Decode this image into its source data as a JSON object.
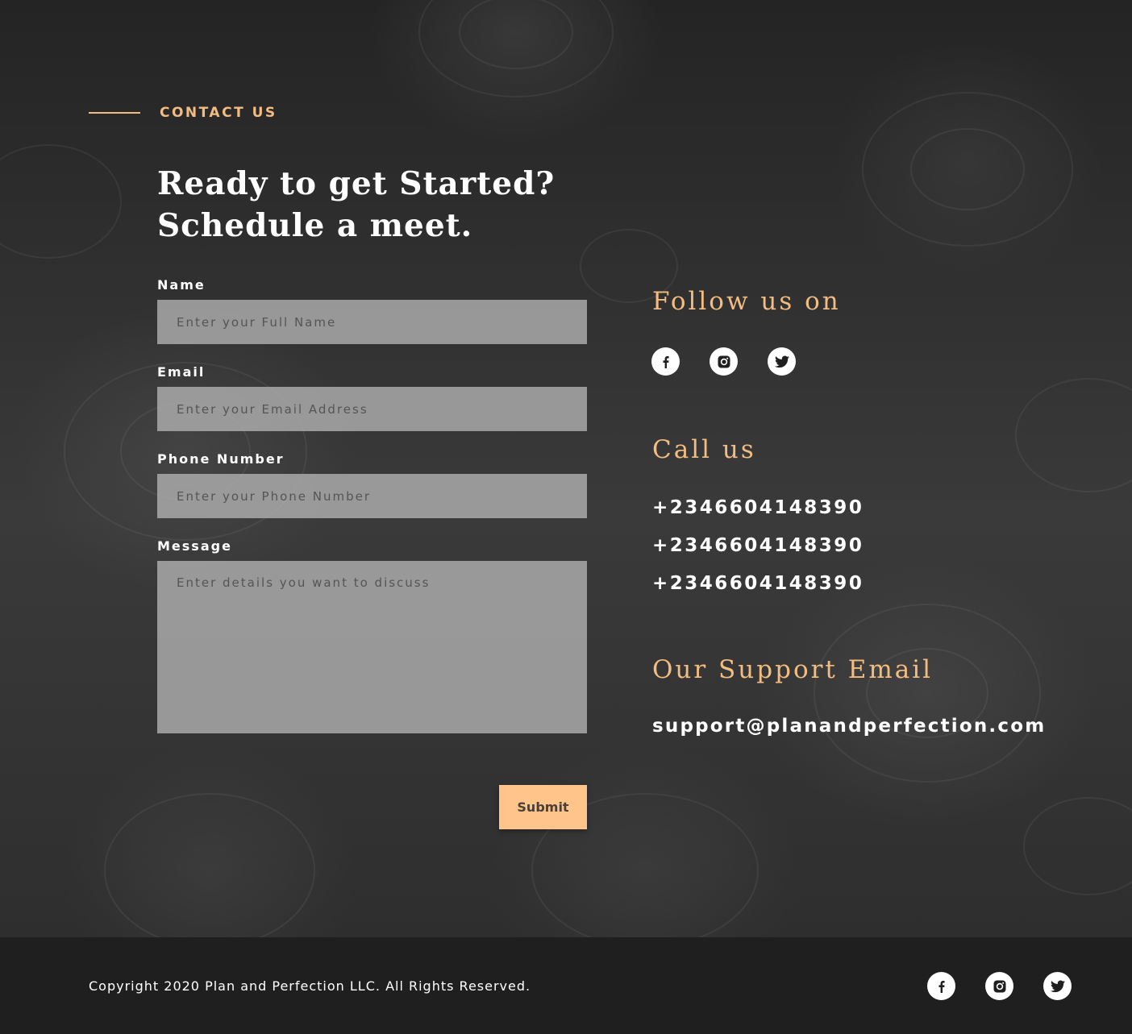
{
  "section": {
    "tag": "CONTACT US"
  },
  "headline": {
    "line1": "Ready to get Started?",
    "line2": "Schedule a meet."
  },
  "form": {
    "name_label": "Name",
    "name_placeholder": "Enter your Full Name",
    "email_label": "Email",
    "email_placeholder": "Enter your Email Address",
    "phone_label": "Phone Number",
    "phone_placeholder": "Enter your Phone Number",
    "message_label": "Message",
    "message_placeholder": "Enter details you want to discuss",
    "submit_label": "Submit"
  },
  "follow": {
    "heading": "Follow us on",
    "icons": [
      "facebook-icon",
      "instagram-icon",
      "twitter-icon"
    ]
  },
  "call": {
    "heading": "Call us",
    "phones": [
      "+2346604148390",
      "+2346604148390",
      "+2346604148390"
    ]
  },
  "support": {
    "heading": "Our Support Email",
    "email": "support@planandperfection.com"
  },
  "footer": {
    "copyright": "Copyright 2020 Plan and Perfection LLC. All Rights Reserved.",
    "icons": [
      "facebook-icon",
      "instagram-icon",
      "twitter-icon"
    ]
  },
  "colors": {
    "accent": "#f3bd82",
    "button": "#ffc48a",
    "input_bg": "#afafaf",
    "footer_bg": "#1f1f1f"
  }
}
